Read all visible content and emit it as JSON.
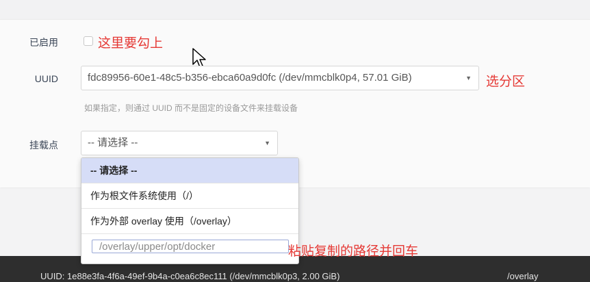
{
  "form": {
    "enabled": {
      "label": "已启用",
      "checked": false
    },
    "uuid": {
      "label": "UUID",
      "selected": "fdc89956-60e1-48c5-b356-ebca60a9d0fc (/dev/mmcblk0p4, 57.01 GiB)",
      "hint": "如果指定，则通过 UUID 而不是固定的设备文件来挂载设备"
    },
    "mountpoint": {
      "label": "挂载点",
      "selected": "-- 请选择 --",
      "options": [
        "-- 请选择 --",
        "作为根文件系统使用（/）",
        "作为外部 overlay 使用（/overlay）"
      ],
      "custom_value": "/overlay/upper/opt/docker"
    }
  },
  "annotations": {
    "check_note": "这里要勾上",
    "partition_note": "选分区",
    "paste_note": "粘贴复制的路径并回车"
  },
  "footer": {
    "uuid_text": "UUID: 1e88e3fa-4f6a-49ef-9b4a-c0ea6c8ec111 (/dev/mmcblk0p3, 2.00 GiB)",
    "mount_text": "/overlay"
  },
  "colors": {
    "annotation": "#e53935",
    "selected_option_bg": "#d6ddf7"
  }
}
